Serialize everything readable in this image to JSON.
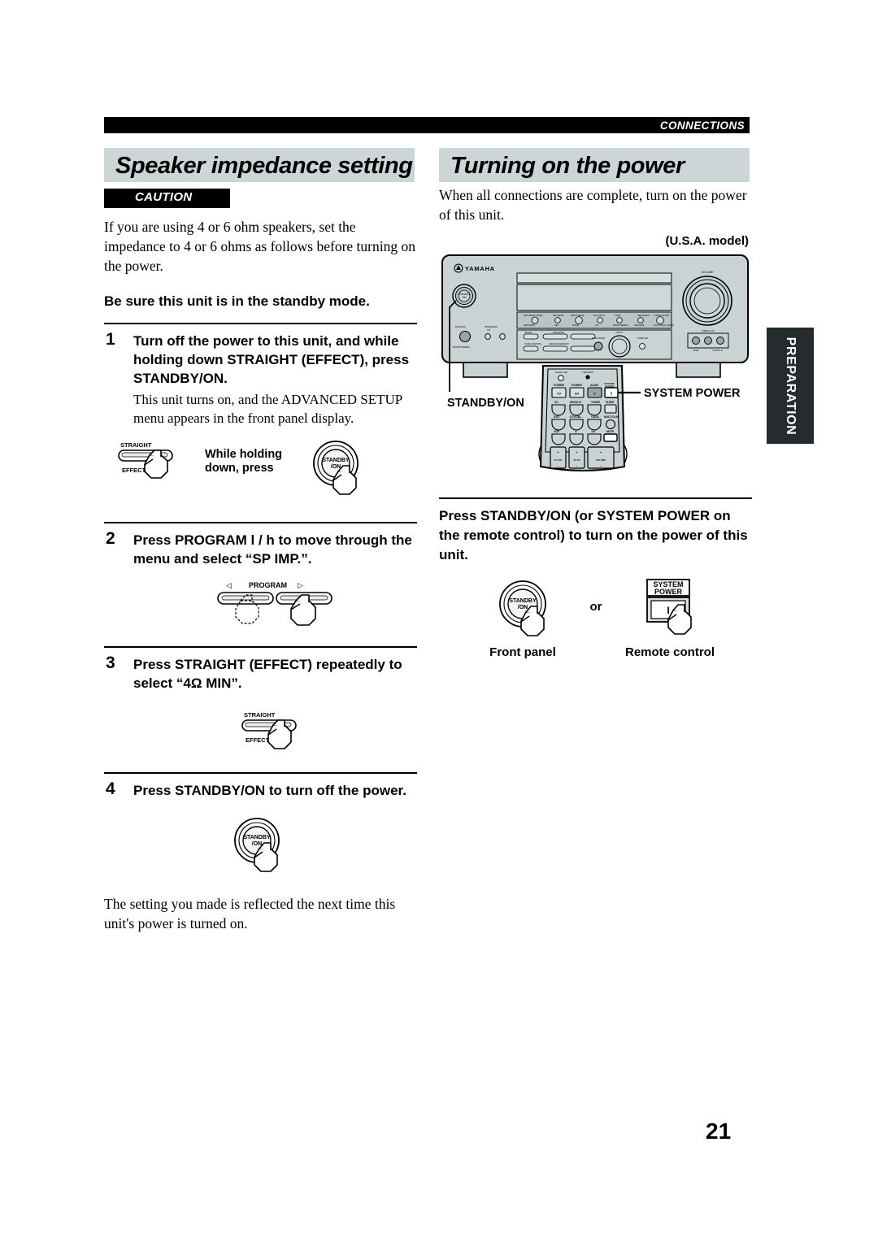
{
  "running_head": {
    "label": "CONNECTIONS"
  },
  "page": {
    "number": "21"
  },
  "side_tab": {
    "label": "PREPARATION"
  },
  "left_column": {
    "title": "Speaker impedance setting",
    "caution": {
      "label": "CAUTION"
    },
    "intro": "If you are using 4 or 6 ohm speakers, set the impedance to 4 or 6 ohms as follows before turning on the power.",
    "lead": "Be sure this unit is in the standby mode.",
    "steps": [
      {
        "number": "1",
        "heading": "Turn off the power to this unit, and while holding down STRAIGHT (EFFECT), press STANDBY/ON.",
        "sub": "This unit turns on, and the ADVANCED SETUP menu appears in the front panel display."
      },
      {
        "number": "2",
        "heading": "Press PROGRAM l  / h  to move through the menu and select “SP IMP.”.",
        "sub": ""
      },
      {
        "number": "3",
        "heading": "Press STRAIGHT (EFFECT) repeatedly to select “4Ω MIN”.",
        "sub": ""
      },
      {
        "number": "4",
        "heading": "Press STANDBY/ON to turn off the power.",
        "sub": ""
      }
    ],
    "figures": {
      "step1": {
        "straight_top": "STRAIGHT",
        "straight_bottom": "EFFECT",
        "instruction_line1": "While holding",
        "instruction_line2": "down, press",
        "knob_line1": "STANDBY",
        "knob_line2": "/ON"
      },
      "step2": {
        "left_arrow": "◁",
        "center_label": "PROGRAM",
        "right_arrow": "▷"
      },
      "step3": {
        "straight_top": "STRAIGHT",
        "straight_bottom": "EFFECT"
      },
      "step4": {
        "knob_line1": "STANDBY",
        "knob_line2": "/ON"
      }
    },
    "closing": "The setting you made is reflected the next time this unit's power is turned on."
  },
  "right_column": {
    "title": "Turning on the power",
    "intro": "When all connections are complete, turn on the power of this unit.",
    "model_label": "(U.S.A. model)",
    "receiver": {
      "brand": "YAMAHA",
      "standbyon_callout": "STANDBY/ON",
      "volume_label": "VOLUME",
      "jack_label": "VIDEO AUX"
    },
    "remote": {
      "system_power_callout": "SYSTEM POWER",
      "rows": [
        [
          "POWER TV",
          "POWER AV",
          "AUDIO",
          "SYSTEM POWER"
        ],
        [
          "CD",
          "MD/CD-R",
          "TUNER",
          "SLEEP"
        ],
        [
          "DVD",
          "DTV/CBL",
          "V-AUX",
          "MULTI DI-IN"
        ],
        [
          "VCR",
          "★",
          "★★",
          "MUTE"
        ]
      ],
      "bottom_buttons": [
        "TV VOL",
        "TV CH",
        "VOLUME"
      ]
    },
    "instruction": "Press STANDBY/ON (or SYSTEM POWER on the remote control) to turn on the power of this unit.",
    "figure": {
      "knob_line1": "STANDBY",
      "knob_line2": "/ON",
      "or": "or",
      "system_label_line1": "SYSTEM",
      "system_label_line2": "POWER",
      "power_symbol": "I",
      "caption_left": "Front panel",
      "caption_right": "Remote control"
    }
  },
  "colors": {
    "title_bar": "#ccd6d6",
    "bar_black": "#000000",
    "tab_dark": "#262b2e",
    "panel_gray": "#c9d3d3",
    "panel_dark": "#aab5b5"
  }
}
